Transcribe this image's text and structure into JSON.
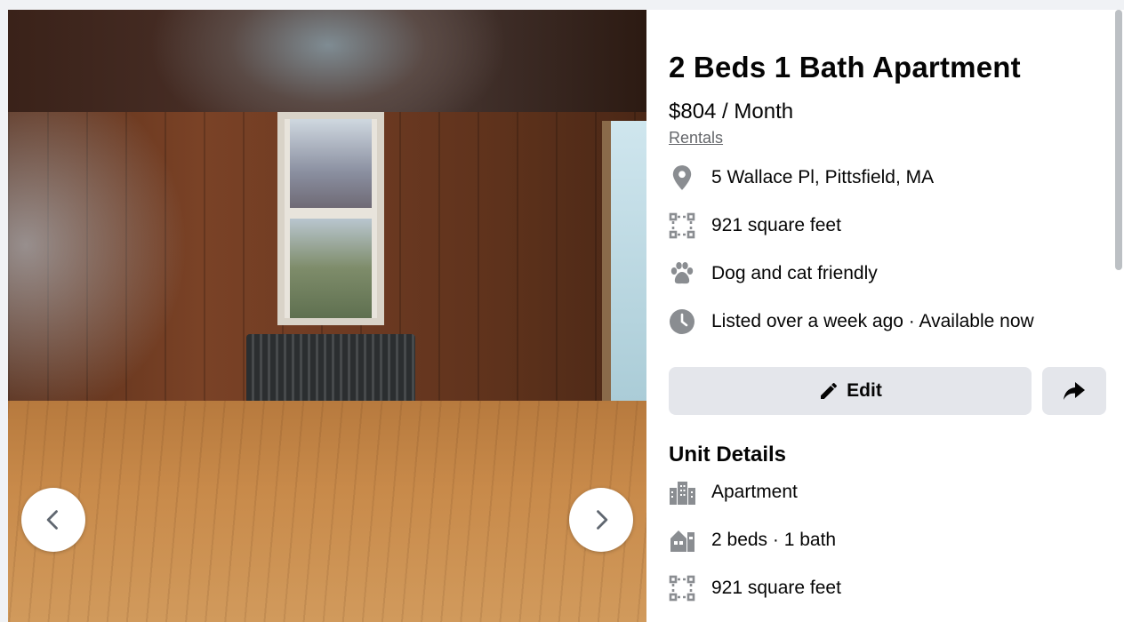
{
  "listing": {
    "title": "2 Beds 1 Bath Apartment",
    "price": "$804 / Month",
    "category": "Rentals",
    "address": "5 Wallace Pl, Pittsfield, MA",
    "size": "921 square feet",
    "pets": "Dog and cat friendly",
    "listed": "Listed over a week ago · Available now"
  },
  "actions": {
    "edit_label": "Edit"
  },
  "unit_details": {
    "heading": "Unit Details",
    "type": "Apartment",
    "rooms": "2 beds · 1 bath",
    "size": "921 square feet"
  },
  "icons": {
    "location": "location-pin-icon",
    "area": "square-footage-icon",
    "pets": "paw-icon",
    "time": "clock-icon",
    "edit": "pencil-icon",
    "share": "share-arrow-icon",
    "building": "building-icon",
    "home": "house-icon",
    "prev": "chevron-left-icon",
    "next": "chevron-right-icon"
  },
  "colors": {
    "icon_gray": "#65676b",
    "button_bg": "#e4e6eb",
    "page_bg": "#f0f2f5"
  }
}
